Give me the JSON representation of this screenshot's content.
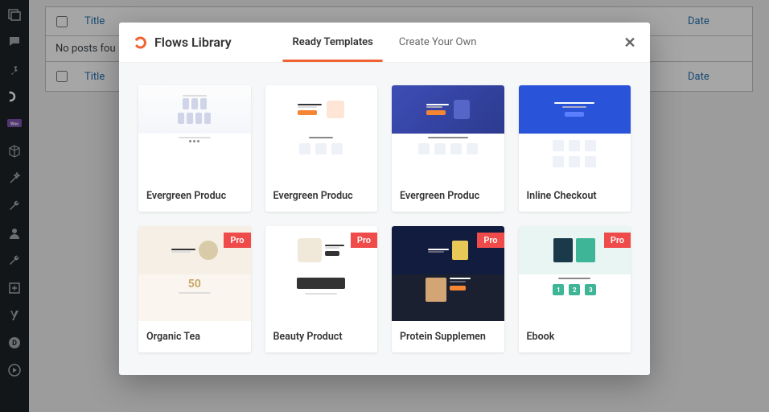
{
  "table": {
    "title_header": "Title",
    "date_header": "Date",
    "empty_text": "No posts fou"
  },
  "modal": {
    "brand_icon": "cf-logo",
    "title": "Flows Library",
    "close_icon": "✕",
    "tabs": [
      {
        "label": "Ready Templates",
        "active": true
      },
      {
        "label": "Create Your Own",
        "active": false
      }
    ],
    "templates": [
      {
        "label": "Evergreen Produc",
        "pro": false,
        "style": "light"
      },
      {
        "label": "Evergreen Produc",
        "pro": false,
        "style": "features"
      },
      {
        "label": "Evergreen Produc",
        "pro": false,
        "style": "dark"
      },
      {
        "label": "Inline Checkout",
        "pro": false,
        "style": "blue"
      },
      {
        "label": "Organic Tea",
        "pro": true,
        "style": "cream"
      },
      {
        "label": "Beauty Product",
        "pro": true,
        "style": "white"
      },
      {
        "label": "Protein Supplemen",
        "pro": true,
        "style": "dark2"
      },
      {
        "label": "Ebook",
        "pro": true,
        "style": "teal"
      }
    ],
    "pro_label": "Pro"
  },
  "sidebar_icons": [
    "collection-icon",
    "comment-icon",
    "pin-icon",
    "flow-icon",
    "woo-icon",
    "cube-icon",
    "magic-icon",
    "wrench-icon",
    "user-icon",
    "settings-icon",
    "plus-box-icon",
    "yoast-icon",
    "divi-icon",
    "play-icon"
  ]
}
